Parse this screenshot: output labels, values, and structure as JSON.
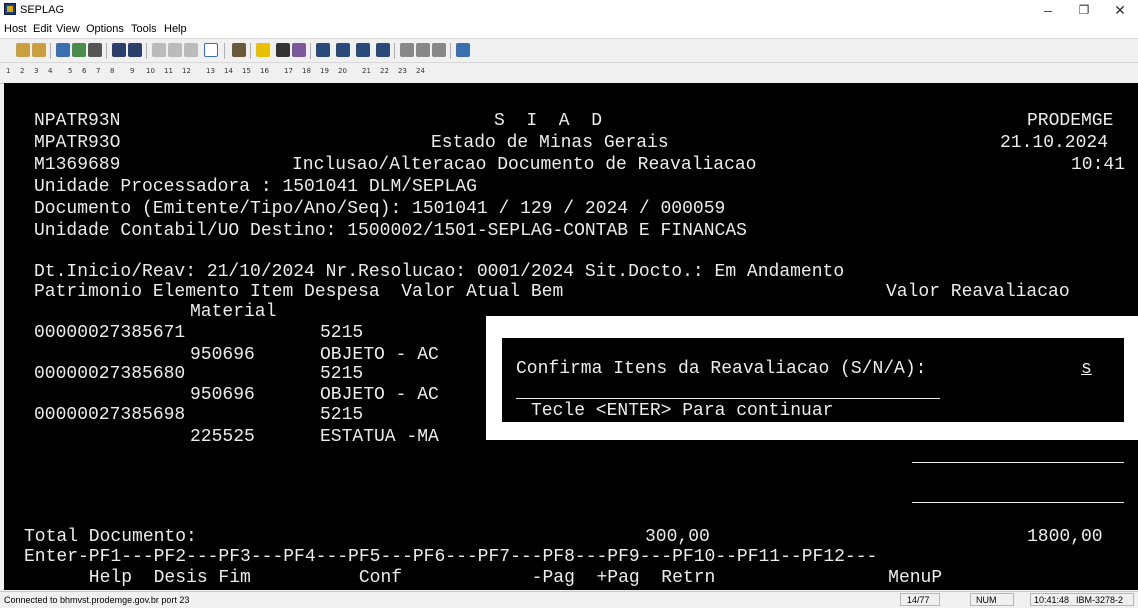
{
  "window": {
    "title": "SEPLAG"
  },
  "menu": [
    "Host",
    "Edit",
    "View",
    "Options",
    "Tools",
    "Help"
  ],
  "pf_keys": [
    "1",
    "2",
    "3",
    "4",
    "5",
    "6",
    "7",
    "8",
    "9",
    "10",
    "11",
    "12",
    "13",
    "14",
    "15",
    "16",
    "17",
    "18",
    "19",
    "20",
    "21",
    "22",
    "23",
    "24"
  ],
  "screen": {
    "r1_left": "NPATR93N",
    "r1_center": "S  I  A  D",
    "r1_right": "PRODEMGE",
    "r2_left": "MPATR93O",
    "r2_center": "Estado de Minas Gerais",
    "r2_right": "21.10.2024",
    "r3_left": "M1369689",
    "r3_center": "Inclusao/Alteracao Documento de Reavaliacao",
    "r3_right": "10:41",
    "unidade_proc": "Unidade Processadora : 1501041 DLM/SEPLAG",
    "documento": "Documento (Emitente/Tipo/Ano/Seq): 1501041 / 129 / 2024 / 000059",
    "unidade_cont": "Unidade Contabil/UO Destino: 1500002/1501-SEPLAG-CONTAB E FINANCAS",
    "dt_inicio": "Dt.Inicio/Reav: 21/10/2024 Nr.Resolucao: 0001/2024 Sit.Docto.: Em Andamento",
    "header_left": "Patrimonio Elemento Item Despesa  Valor Atual Bem",
    "header_right": "Valor Reavaliacao",
    "header_material": "Material",
    "items": [
      {
        "patrimonio": "00000027385671",
        "elemento": "5215",
        "material": "950696",
        "desc": "OBJETO - AC"
      },
      {
        "patrimonio": "00000027385680",
        "elemento": "5215",
        "material": "950696",
        "desc": "OBJETO - AC"
      },
      {
        "patrimonio": "00000027385698",
        "elemento": "5215",
        "material": "225525",
        "desc": "ESTATUA -MA"
      }
    ],
    "total_label": "Total Documento:",
    "total_atual": "300,00",
    "total_reav": "1800,00",
    "pf_line": "Enter-PF1---PF2---PF3---PF4---PF5---PF6---PF7---PF8---PF9---PF10--PF11--PF12---",
    "pf_labels": "      Help  Desis Fim          Conf            -Pag  +Pag  Retrn                MenuP"
  },
  "dialog": {
    "prompt": "Confirma Itens da Reavaliacao (S/N/A):",
    "value": "s",
    "hint": "Tecle <ENTER> Para continuar"
  },
  "status": {
    "connection": "Connected to bhmvst.prodemge.gov.br port 23",
    "cursor": "14/77",
    "num": "NUM",
    "time": "10:41:48",
    "terminal": "IBM-3278-2"
  }
}
